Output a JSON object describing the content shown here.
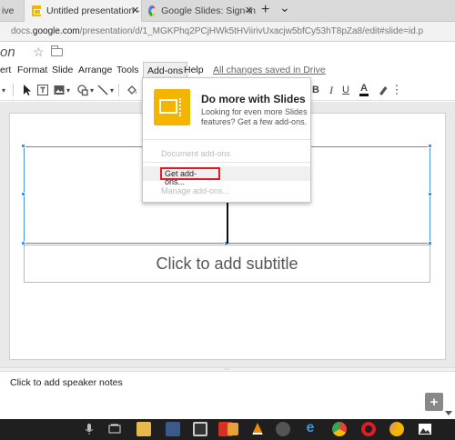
{
  "browser": {
    "tabs": [
      {
        "label": "ive"
      },
      {
        "label": "Untitled presentation - "
      },
      {
        "label": "Google Slides: Sign-in"
      }
    ],
    "close_glyph": "✕",
    "new_tab_glyph": "+",
    "tab_list_glyph": "⌄",
    "url_prefix": "docs.",
    "url_domain": "google.com",
    "url_path": "/presentation/d/1_MGKPhq2PCjHWk5tHViirivUxacjw5bfCy53hT8pZa8/edit#slide=id.p"
  },
  "doc": {
    "title": "on",
    "star_glyph": "☆"
  },
  "menubar": {
    "items": [
      "ert",
      "Format",
      "Slide",
      "Arrange",
      "Tools",
      "Add-ons",
      "Help"
    ],
    "save_status": "All changes saved in Drive"
  },
  "toolbar": {
    "bold": "B",
    "italic": "I",
    "underline": "U",
    "text_color": "A",
    "more": "⋮"
  },
  "slide": {
    "subtitle_placeholder": "Click to add subtitle"
  },
  "notes": {
    "placeholder": "Click to add speaker notes",
    "grip": "⋯"
  },
  "addons_menu": {
    "promo_title": "Do more with Slides",
    "promo_description": "Looking for even more Slides features? Get a few add-ons.",
    "document_addons": "Document add-ons",
    "get_addons": "Get add-ons...",
    "manage_addons": "Manage add-ons..."
  },
  "colors": {
    "selection_blue": "#4a90e2",
    "slides_yellow": "#f4b400",
    "highlight_red": "#e01b24"
  }
}
